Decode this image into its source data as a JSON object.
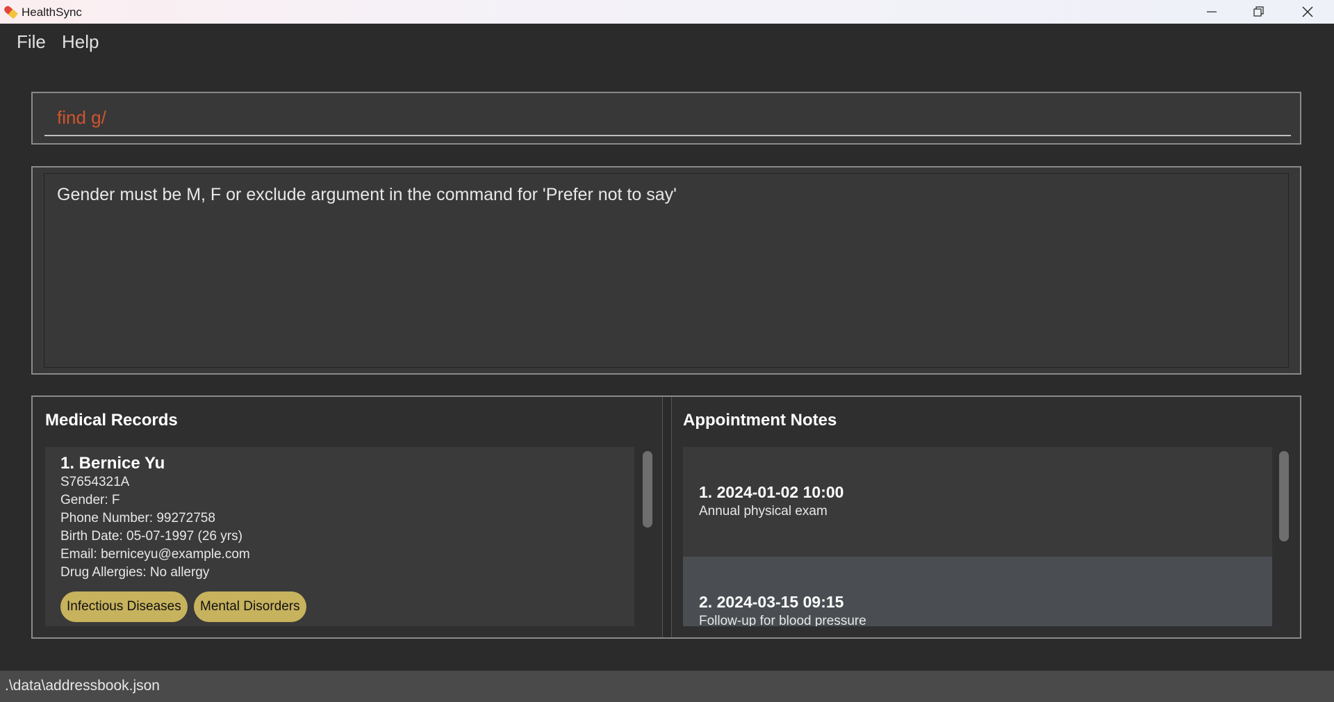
{
  "window": {
    "title": "HealthSync",
    "app_icon": "pill-icon",
    "controls": [
      "minimize-icon",
      "restore-icon",
      "close-icon"
    ]
  },
  "menu": {
    "file": "File",
    "help": "Help"
  },
  "command": {
    "value": "find g/"
  },
  "result": {
    "message": "Gender must be M, F or exclude argument in the command for 'Prefer not to say'"
  },
  "records": {
    "title": "Medical Records",
    "items": [
      {
        "name": "1.  Bernice Yu",
        "nric": "S7654321A",
        "gender": "Gender: F",
        "phone": "Phone Number: 99272758",
        "birth": "Birth Date: 05-07-1997 (26 yrs)",
        "email": "Email: berniceyu@example.com",
        "allergies": "Drug Allergies: No allergy",
        "tags": [
          "Infectious Diseases",
          "Mental Disorders"
        ]
      }
    ]
  },
  "notes": {
    "title": "Appointment Notes",
    "items": [
      {
        "heading": "1.  2024-01-02 10:00",
        "description": "Annual physical exam"
      },
      {
        "heading": "2.  2024-03-15 09:15",
        "description": "Follow-up for blood pressure"
      }
    ]
  },
  "status": {
    "path": ".\\data\\addressbook.json"
  },
  "colors": {
    "background": "#2b2b2b",
    "command_text": "#d0542e",
    "tag": "#c7b25d",
    "selected_note": "#4a4e52"
  }
}
